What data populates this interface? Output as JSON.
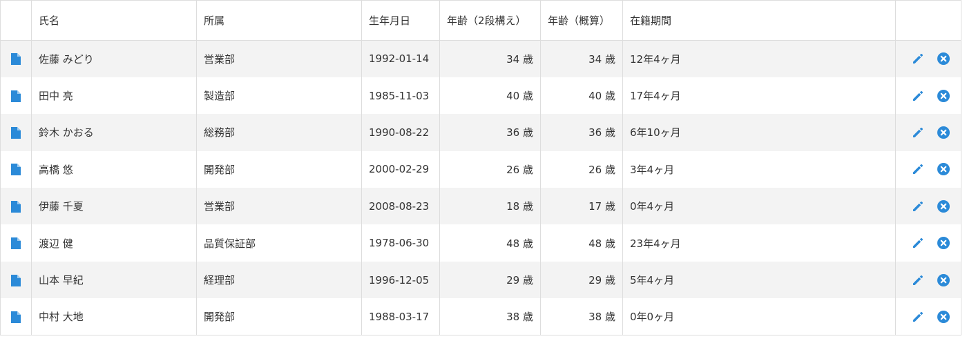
{
  "colors": {
    "accent": "#2b8ad8",
    "row_stripe": "#f3f3f3",
    "border": "#dddddd"
  },
  "table": {
    "columns": [
      {
        "key": "icon",
        "label": ""
      },
      {
        "key": "name",
        "label": "氏名"
      },
      {
        "key": "dept",
        "label": "所属"
      },
      {
        "key": "birth",
        "label": "生年月日"
      },
      {
        "key": "age2",
        "label": "年齢（2段構え）"
      },
      {
        "key": "age_approx",
        "label": "年齢（概算）"
      },
      {
        "key": "tenure",
        "label": "在籍期間"
      },
      {
        "key": "actions",
        "label": ""
      }
    ],
    "row_icons": {
      "document": "document-icon",
      "edit": "pencil-edit-icon",
      "delete": "close-circle-icon"
    },
    "rows": [
      {
        "name": "佐藤 みどり",
        "dept": "営業部",
        "birth": "1992-01-14",
        "age2": "34 歳",
        "age_approx": "34 歳",
        "tenure": "12年4ヶ月"
      },
      {
        "name": "田中 亮",
        "dept": "製造部",
        "birth": "1985-11-03",
        "age2": "40 歳",
        "age_approx": "40 歳",
        "tenure": "17年4ヶ月"
      },
      {
        "name": "鈴木 かおる",
        "dept": "総務部",
        "birth": "1990-08-22",
        "age2": "36 歳",
        "age_approx": "36 歳",
        "tenure": "6年10ヶ月"
      },
      {
        "name": "高橋 悠",
        "dept": "開発部",
        "birth": "2000-02-29",
        "age2": "26 歳",
        "age_approx": "26 歳",
        "tenure": "3年4ヶ月"
      },
      {
        "name": "伊藤 千夏",
        "dept": "営業部",
        "birth": "2008-08-23",
        "age2": "18 歳",
        "age_approx": "17 歳",
        "tenure": "0年4ヶ月"
      },
      {
        "name": "渡辺 健",
        "dept": "品質保証部",
        "birth": "1978-06-30",
        "age2": "48 歳",
        "age_approx": "48 歳",
        "tenure": "23年4ヶ月"
      },
      {
        "name": "山本 早紀",
        "dept": "経理部",
        "birth": "1996-12-05",
        "age2": "29 歳",
        "age_approx": "29 歳",
        "tenure": "5年4ヶ月"
      },
      {
        "name": "中村 大地",
        "dept": "開発部",
        "birth": "1988-03-17",
        "age2": "38 歳",
        "age_approx": "38 歳",
        "tenure": "0年0ヶ月"
      }
    ]
  }
}
